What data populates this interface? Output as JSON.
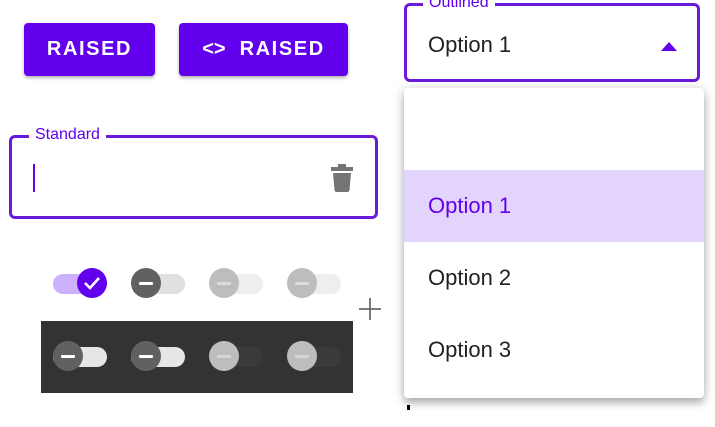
{
  "buttons": {
    "raised_label": "RAISED",
    "icon_raised_label": "RAISED",
    "icon_raised_icon": "code-icon"
  },
  "outlined_select": {
    "label": "Outlined",
    "value": "Option 1",
    "options": [
      "",
      "Option 1",
      "Option 2",
      "Option 3"
    ],
    "selected_index": 1
  },
  "standard_field": {
    "label": "Standard",
    "value": "",
    "trailing_icon": "trash-icon"
  },
  "switches": {
    "light_row": [
      {
        "state": "checked",
        "thumb_icon": "check-icon"
      },
      {
        "state": "unchecked",
        "thumb_icon": "minus-icon"
      },
      {
        "state": "disabled-unchecked",
        "thumb_icon": "minus-icon"
      },
      {
        "state": "disabled-unchecked",
        "thumb_icon": "minus-icon"
      }
    ],
    "dark_row": [
      {
        "state": "unchecked",
        "thumb_icon": "minus-icon"
      },
      {
        "state": "unchecked",
        "thumb_icon": "minus-icon"
      },
      {
        "state": "disabled-unchecked",
        "thumb_icon": "minus-icon"
      },
      {
        "state": "disabled-unchecked",
        "thumb_icon": "minus-icon"
      }
    ]
  },
  "colors": {
    "primary": "#6200ee",
    "selected_option_bg": "#e2d4fc",
    "dark_panel": "#333333"
  }
}
